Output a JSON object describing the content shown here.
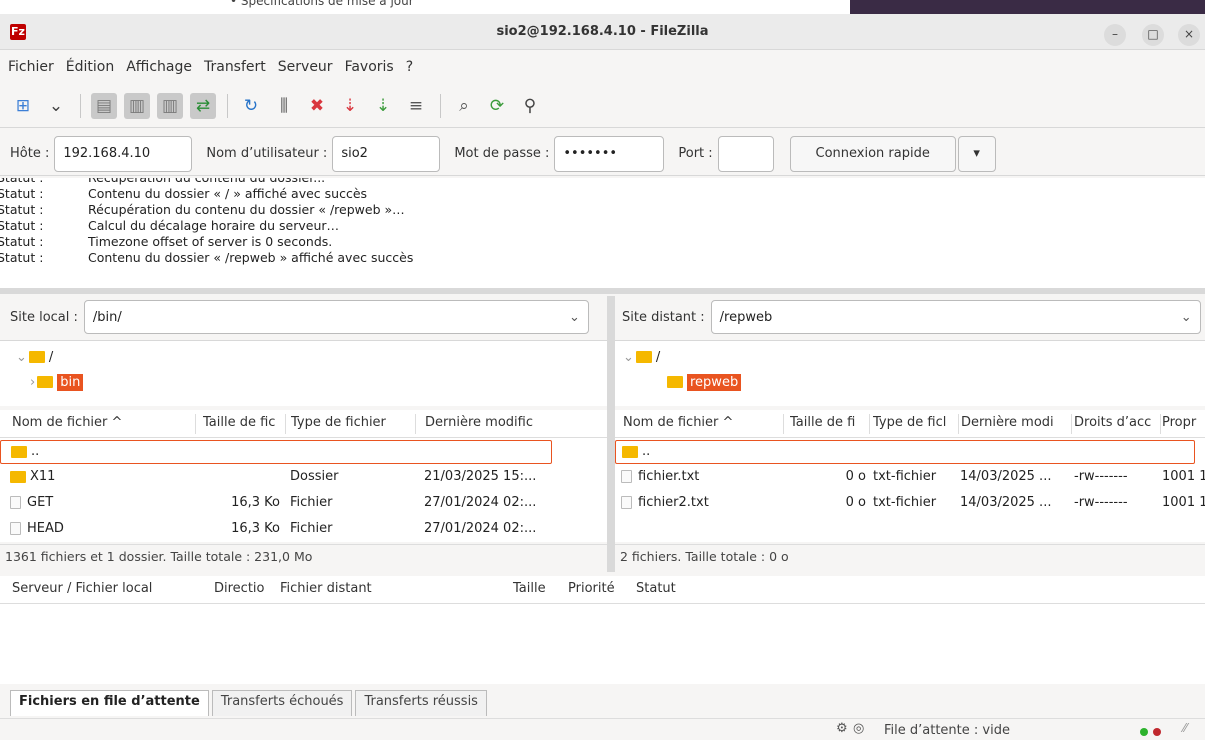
{
  "window": {
    "title": "sio2@192.168.4.10 - FileZilla",
    "app_icon_letter": "Fz",
    "background_text": "• Spécifications de mise à jour"
  },
  "menu": [
    "Fichier",
    "Édition",
    "Affichage",
    "Transfert",
    "Serveur",
    "Favoris",
    "?"
  ],
  "toolbar": {
    "icons": [
      {
        "name": "site-manager-icon",
        "glyph": "⊞",
        "color": "#3c7fd6"
      },
      {
        "name": "dropdown-arrow-icon",
        "glyph": "⌄",
        "color": "#444"
      },
      {
        "name": "toggle-log-icon",
        "glyph": "▤",
        "color": "#7a7a7a"
      },
      {
        "name": "toggle-local-tree-icon",
        "glyph": "▥",
        "color": "#7a7a7a"
      },
      {
        "name": "toggle-remote-tree-icon",
        "glyph": "▥",
        "color": "#7a7a7a"
      },
      {
        "name": "toggle-queue-icon",
        "glyph": "⇄",
        "color": "#2a8d36"
      },
      {
        "name": "refresh-icon",
        "glyph": "↻",
        "color": "#2673c9"
      },
      {
        "name": "process-queue-icon",
        "glyph": "⫼",
        "color": "#555"
      },
      {
        "name": "cancel-icon",
        "glyph": "✖",
        "color": "#d9363e"
      },
      {
        "name": "disconnect-icon",
        "glyph": "⇣",
        "color": "#d9363e"
      },
      {
        "name": "reconnect-icon",
        "glyph": "⇣",
        "color": "#3a9b3a"
      },
      {
        "name": "directory-compare-icon",
        "glyph": "≡",
        "color": "#555"
      },
      {
        "name": "filter-icon",
        "glyph": "⌕",
        "color": "#555"
      },
      {
        "name": "sync-browsing-icon",
        "glyph": "⟳",
        "color": "#3a9b3a"
      },
      {
        "name": "search-icon",
        "glyph": "⚲",
        "color": "#444"
      }
    ]
  },
  "quickconnect": {
    "host_label": "Hôte :",
    "host_value": "192.168.4.10",
    "user_label": "Nom d’utilisateur :",
    "user_value": "sio2",
    "pass_label": "Mot de passe :",
    "pass_value": "•••••••",
    "port_label": "Port :",
    "port_value": "",
    "connect_label": "Connexion rapide",
    "dropdown_icon": "▾"
  },
  "log": [
    {
      "key": "Statut :",
      "value": "Récupération du contenu du dossier..."
    },
    {
      "key": "Statut :",
      "value": "Contenu du dossier « / » affiché avec succès"
    },
    {
      "key": "Statut :",
      "value": "Récupération du contenu du dossier « /repweb »…"
    },
    {
      "key": "Statut :",
      "value": "Calcul du décalage horaire du serveur…"
    },
    {
      "key": "Statut :",
      "value": "Timezone offset of server is 0 seconds."
    },
    {
      "key": "Statut :",
      "value": "Contenu du dossier « /repweb » affiché avec succès"
    }
  ],
  "local": {
    "site_label": "Site local :",
    "path": "/bin/",
    "tree": [
      {
        "label": "/",
        "selected": false
      },
      {
        "label": "bin",
        "selected": true
      }
    ],
    "headers": [
      "Nom de fichier ^",
      "Taille de fic",
      "Type de fichier",
      "Dernière modific"
    ],
    "files": [
      {
        "name": "..",
        "size": "",
        "type": "",
        "modified": ""
      },
      {
        "name": "X11",
        "size": "",
        "type": "Dossier",
        "modified": "21/03/2025 15:..."
      },
      {
        "name": "GET",
        "size": "16,3 Ko",
        "type": "Fichier",
        "modified": "27/01/2024 02:..."
      },
      {
        "name": "HEAD",
        "size": "16,3 Ko",
        "type": "Fichier",
        "modified": "27/01/2024 02:..."
      }
    ],
    "status": "1361 fichiers et 1 dossier. Taille totale : 231,0 Mo"
  },
  "remote": {
    "site_label": "Site distant :",
    "path": "/repweb",
    "tree": [
      {
        "label": "/",
        "selected": false
      },
      {
        "label": "repweb",
        "selected": true
      }
    ],
    "headers": [
      "Nom de fichier ^",
      "Taille de fi",
      "Type de ficl",
      "Dernière modi",
      "Droits d’acc",
      "Propr"
    ],
    "files": [
      {
        "name": "..",
        "size": "",
        "type": "",
        "modified": "",
        "perms": "",
        "owner": ""
      },
      {
        "name": "fichier.txt",
        "size": "0 o",
        "type": "txt-fichier",
        "modified": "14/03/2025 ...",
        "perms": "-rw-------",
        "owner": "1001 1"
      },
      {
        "name": "fichier2.txt",
        "size": "0 o",
        "type": "txt-fichier",
        "modified": "14/03/2025 ...",
        "perms": "-rw-------",
        "owner": "1001 1"
      }
    ],
    "status": "2 fichiers. Taille totale : 0 o"
  },
  "queue": {
    "headers": [
      "Serveur / Fichier local",
      "Directio",
      "Fichier distant",
      "Taille",
      "Priorité",
      "Statut"
    ],
    "tabs": [
      "Fichiers en file d’attente",
      "Transferts échoués",
      "Transferts réussis"
    ],
    "status": "File d’attente : vide"
  },
  "colors": {
    "accent": "#e95420",
    "folder": "#f5b800",
    "led_green": "#2db32d",
    "led_red": "#c0282e"
  }
}
